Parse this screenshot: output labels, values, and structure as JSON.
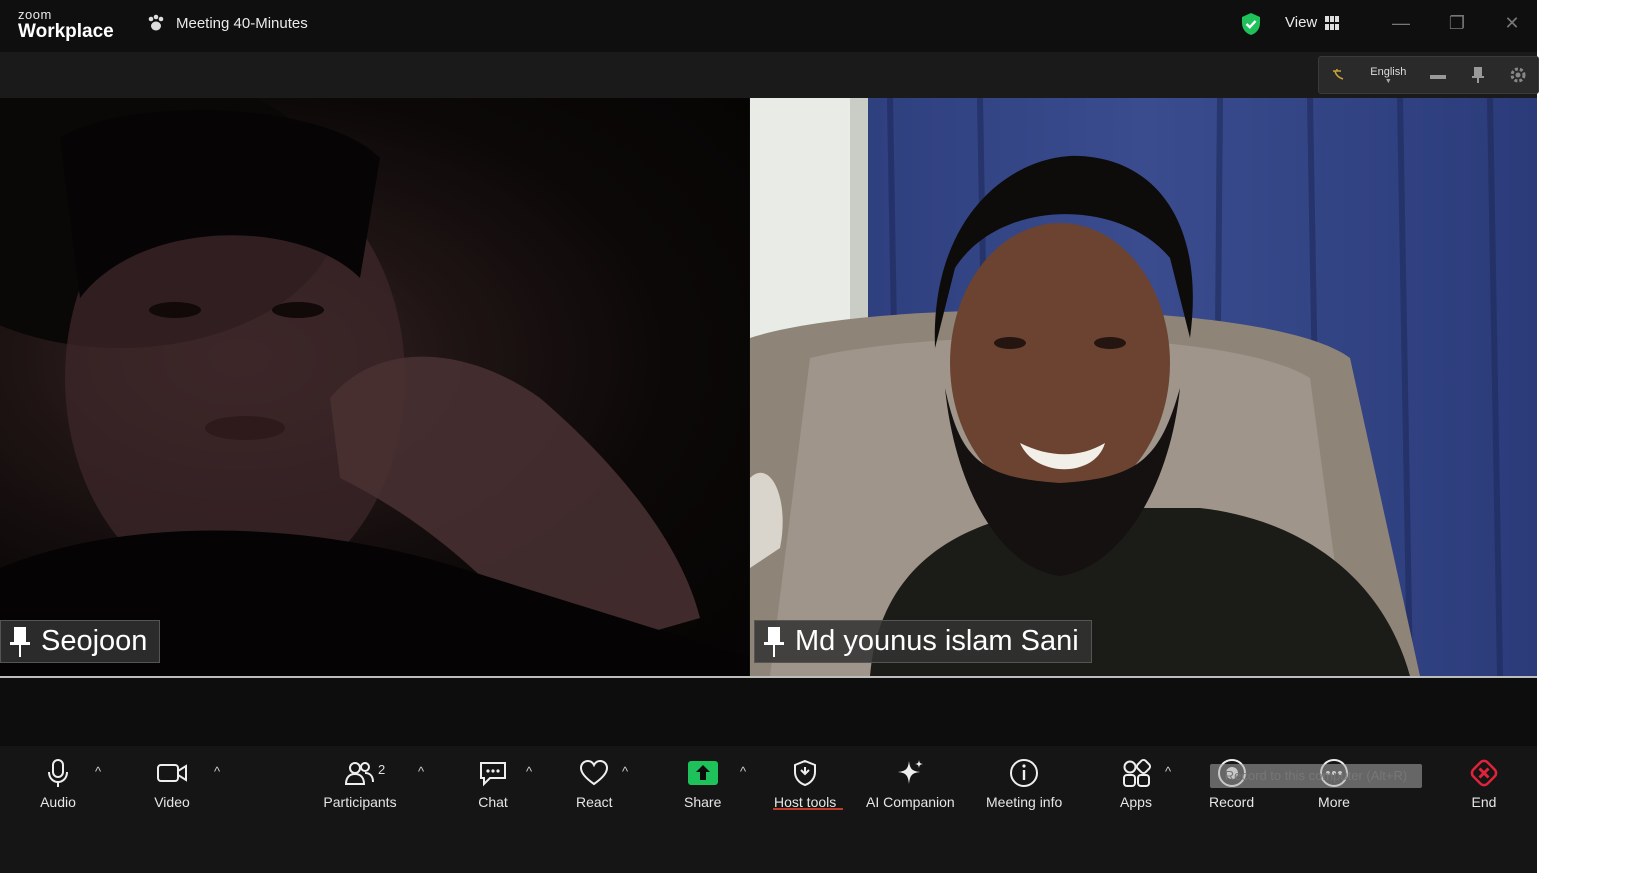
{
  "app": {
    "logo_line1": "zoom",
    "logo_line2": "Workplace",
    "meeting_title": "Meeting 40-Minutes",
    "view_label": "View"
  },
  "floating_toolbar": {
    "language": "English"
  },
  "participants": [
    {
      "name": "Seojoon"
    },
    {
      "name": "Md younus islam Sani"
    }
  ],
  "toolbar": {
    "audio": "Audio",
    "video": "Video",
    "participants": "Participants",
    "participants_count": "2",
    "chat": "Chat",
    "react": "React",
    "share": "Share",
    "host_tools": "Host tools",
    "ai_companion": "AI Companion",
    "meeting_info": "Meeting info",
    "apps": "Apps",
    "record": "Record",
    "more": "More",
    "end": "End",
    "record_tooltip": "Record to this computer (Alt+R)"
  },
  "colors": {
    "accent_green": "#1fc15a",
    "end_red": "#e0233b",
    "host_tools_underline": "#c0392b"
  }
}
